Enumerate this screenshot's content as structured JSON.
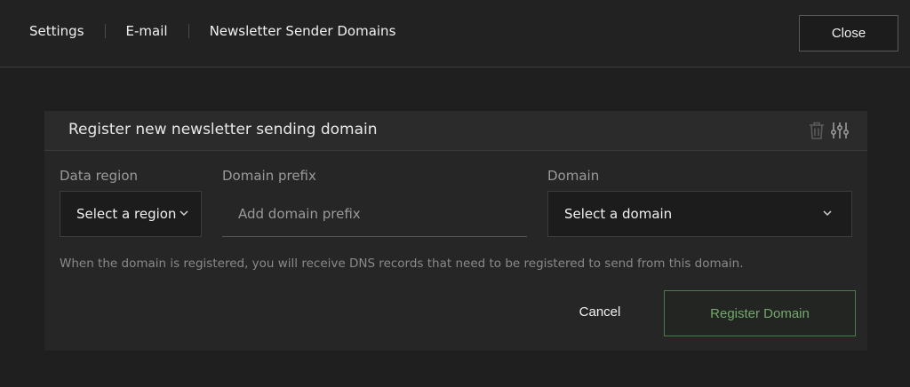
{
  "breadcrumb": {
    "items": [
      "Settings",
      "E-mail",
      "Newsletter Sender Domains"
    ]
  },
  "header": {
    "close_label": "Close"
  },
  "card": {
    "title": "Register new newsletter sending domain",
    "icons": [
      "trash-icon",
      "sliders-icon"
    ]
  },
  "form": {
    "data_region": {
      "label": "Data region",
      "selected": "Select a region"
    },
    "domain_prefix": {
      "label": "Domain prefix",
      "placeholder": "Add domain prefix",
      "value": ""
    },
    "domain": {
      "label": "Domain",
      "selected": "Select a domain"
    },
    "note": "When the domain is registered, you will receive DNS records that need to be registered to send from this domain.",
    "cancel_label": "Cancel",
    "submit_label": "Register Domain"
  },
  "colors": {
    "background": "#1f1f1f",
    "card": "#262626",
    "accent_green": "#74a86c",
    "accent_green_border": "#4d7a4a"
  }
}
